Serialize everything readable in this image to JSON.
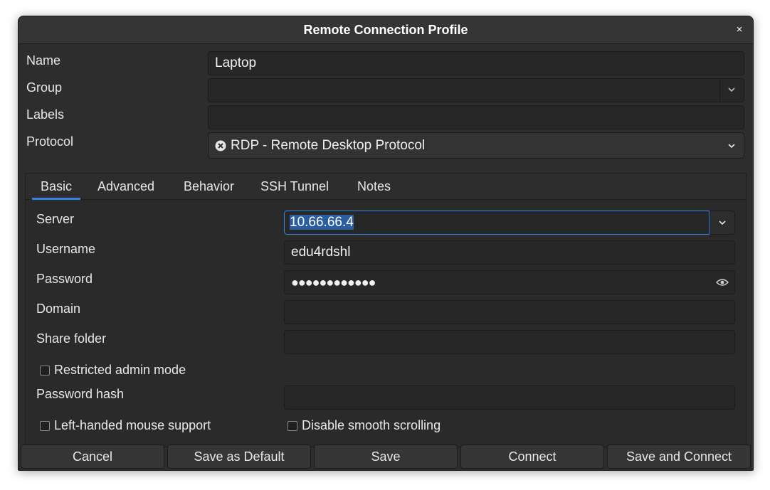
{
  "window": {
    "title": "Remote Connection Profile",
    "close_glyph": "×"
  },
  "profile": {
    "name_label": "Name",
    "name_value": "Laptop",
    "group_label": "Group",
    "group_value": "",
    "labels_label": "Labels",
    "labels_value": "",
    "protocol_label": "Protocol",
    "protocol_value": "RDP - Remote Desktop Protocol",
    "protocol_icon": "rdp-icon"
  },
  "tabs": [
    {
      "label": "Basic",
      "active": true
    },
    {
      "label": "Advanced",
      "active": false
    },
    {
      "label": "Behavior",
      "active": false
    },
    {
      "label": "SSH Tunnel",
      "active": false
    },
    {
      "label": "Notes",
      "active": false
    }
  ],
  "basic": {
    "server_label": "Server",
    "server_value": "10.66.66.4",
    "username_label": "Username",
    "username_value": "edu4rdshl",
    "password_label": "Password",
    "password_value": "●●●●●●●●●●●●",
    "domain_label": "Domain",
    "domain_value": "",
    "share_label": "Share folder",
    "share_value": "",
    "restricted_label": "Restricted admin mode",
    "restricted_checked": false,
    "hash_label": "Password hash",
    "hash_value": "",
    "lefthanded_label": "Left-handed mouse support",
    "lefthanded_checked": false,
    "smooth_label": "Disable smooth scrolling",
    "smooth_checked": false
  },
  "buttons": {
    "cancel": "Cancel",
    "save_default": "Save as Default",
    "save": "Save",
    "connect": "Connect",
    "save_connect": "Save and Connect"
  },
  "colors": {
    "accent": "#3584e4",
    "selection": "#2a5e9e",
    "background": "#2d2d2d"
  }
}
